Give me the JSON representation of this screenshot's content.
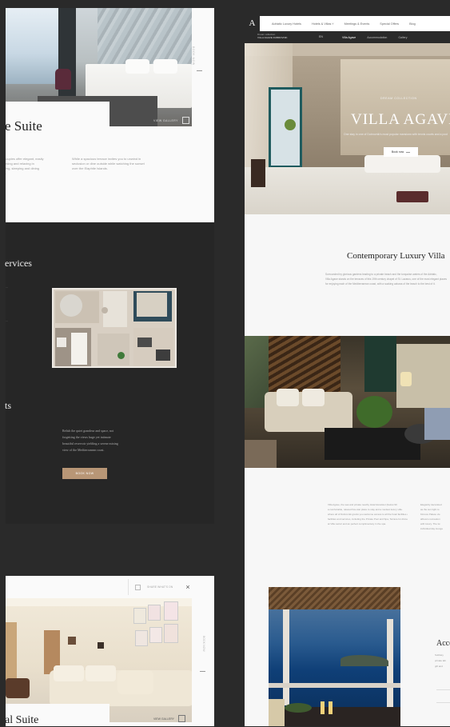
{
  "left": {
    "suite1": {
      "title": "e Suite",
      "view_gallery": "VIEW GALLERY",
      "side_label": "BOOK NOW",
      "col1": [
        "ouples offer elegant, easily",
        "rking and relaxing in",
        "ing, sleeping and dining",
        "."
      ],
      "col2": [
        "While a spacious terrace invites you to unwind in",
        "seclusion or dine outside while watching the sunset",
        "over the Elaphite Islands."
      ]
    },
    "services": {
      "title": "ervices",
      "items": [
        "...",
        "..."
      ],
      "subtitle": "ts",
      "description": [
        "Relish the quiet grandeur and space, not",
        "forgetting the views huge yet intimate",
        "beautiful reservoir yielding a serene mixing",
        "view of the Mediterranean coast."
      ],
      "button": "BOOK NOW"
    },
    "suite2": {
      "bar_text": "SHARE WHAT'S ON",
      "close": "×",
      "side_label": "BOOK NOW",
      "view_gallery": "VIEW GALLERY",
      "title": "al Suite"
    }
  },
  "right": {
    "logo": "A",
    "nav": [
      "Adriatic Luxury Hotels",
      "Hotels & Villas",
      "Meetings & Events",
      "Special Offers",
      "Blog"
    ],
    "nav_chevron": "˅",
    "subbar_brand_line1": "Dream collection",
    "subbar_brand_line2": "VILLA AGAVE DUBROVNIK",
    "subbar_flag": "EN",
    "subbar_links": [
      "Villa Agave",
      "Accommodation",
      "Gallery"
    ],
    "hero": {
      "kicker": "DREAM COLLECTION",
      "title": "VILLA AGAVE",
      "tagline": "One stay in one of Dubrovnik's most popular mansions with tennis courts and a pool",
      "button": "Book now"
    },
    "intro": {
      "heading": "Contemporary Luxury Villa",
      "lines": [
        "Surrounded by glorious gardens leading to a private beach and the turquoise waters of the Adriatic,",
        "Villa Agave stands on the terraces of this 19th century chapel of St. Lazarus, one of the most elegant places",
        "for enjoying each of the Mediterranean coast, with a soaking cabana of the beach to the best of it."
      ]
    },
    "mid_text": {
      "col1": [
        "Villa Agave, the sea and private nearby Hotel Excelsior (below 90",
        "a comfortable, relaxed five-star place to stay and a modest luxury villa.",
        "where all of Dubrovnik grants you welcome access to all the hotel facilities and",
        "facilities and services, including the Private Pool and Spa, Terrace for dinner",
        "at Villa Lazuri and an perfect complimentary in the spa."
      ],
      "col2": [
        "Elegantly decorated",
        "as the sun light to",
        "Kinross Palace vie",
        "alfresco recreation",
        "with luxury. The tw",
        "individual day lounge"
      ]
    },
    "access": {
      "title": "Acce",
      "lines": [
        "Subtlety",
        "private lab",
        "gift and"
      ]
    }
  }
}
